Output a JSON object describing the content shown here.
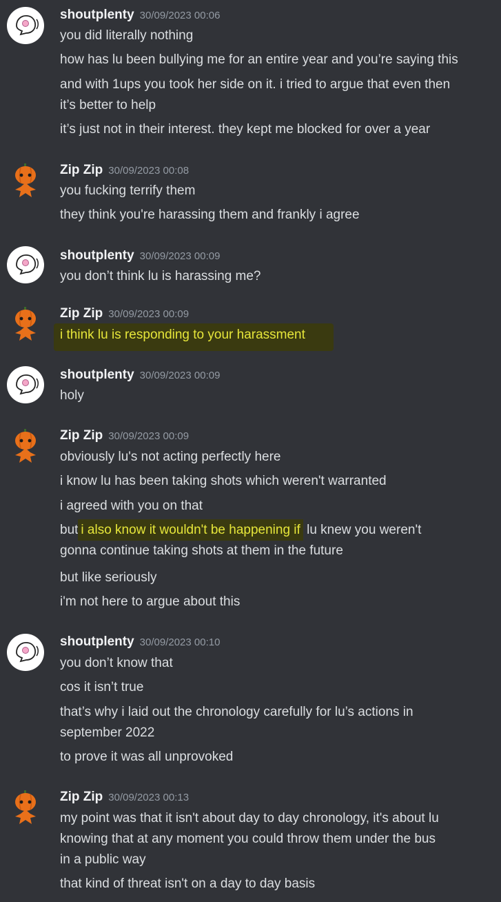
{
  "messages": [
    {
      "user": "shoutplenty",
      "time": "30/09/2023 00:06",
      "lines": [
        "you did literally nothing",
        "how has lu been bullying me for an entire year and you’re saying this",
        "and with 1ups you took her side on it. i tried to argue that even then",
        "it’s better to help",
        "it’s just not in their interest. they kept me blocked for over a year"
      ]
    },
    {
      "user": "Zip Zip",
      "time": "30/09/2023 00:08",
      "lines": [
        "you fucking terrify them",
        "they think you're harassing them and frankly i agree"
      ]
    },
    {
      "user": "shoutplenty",
      "time": "30/09/2023 00:09",
      "lines": [
        "you don’t think lu is harassing me?"
      ]
    },
    {
      "user": "Zip Zip",
      "time": "30/09/2023 00:09",
      "lines": [
        "i think lu is responding to your harassment"
      ]
    },
    {
      "user": "shoutplenty",
      "time": "30/09/2023 00:09",
      "lines": [
        "holy"
      ]
    },
    {
      "user": "Zip Zip",
      "time": "30/09/2023 00:09",
      "lines": [
        "obviously lu's not acting perfectly here",
        "i know lu has been taking shots which weren't warranted",
        "i agreed with you on that",
        "but",
        "i also know it wouldn't be happening if",
        "lu knew you weren't",
        "gonna continue taking shots at them in the future",
        "but like seriously",
        "i'm not here to argue about this"
      ]
    },
    {
      "user": "shoutplenty",
      "time": "30/09/2023 00:10",
      "lines": [
        "you don’t know that",
        "cos it isn’t true",
        "that’s why i laid out the chronology carefully for lu’s actions in",
        "september 2022",
        "to prove it was all unprovoked"
      ]
    },
    {
      "user": "Zip Zip",
      "time": "30/09/2023 00:13",
      "lines": [
        "my point was that it isn't about day to day chronology, it's about lu",
        "knowing that at any moment you could throw them under the bus",
        "in a public way",
        "that kind of threat isn't on a day to day basis"
      ]
    }
  ]
}
